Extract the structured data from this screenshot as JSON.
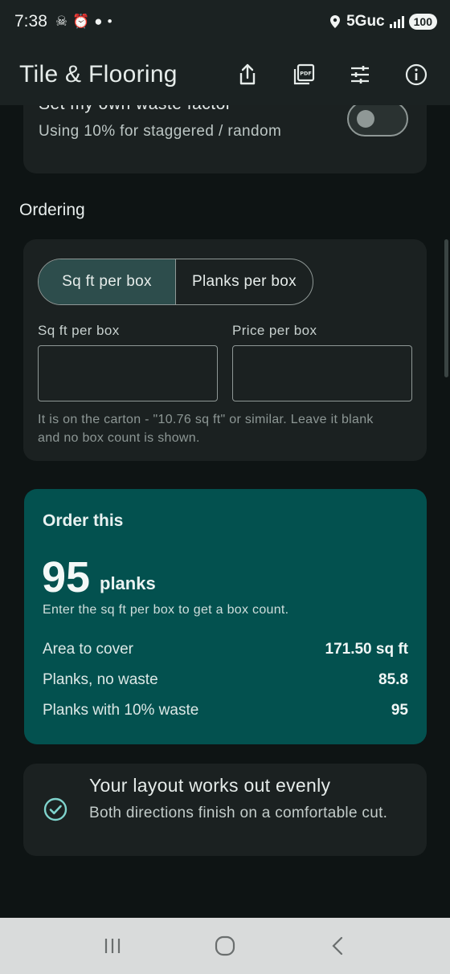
{
  "status_bar": {
    "time": "7:38",
    "network": "5Guc",
    "battery": "100"
  },
  "app_bar": {
    "title": "Tile & Flooring",
    "actions": [
      "share-icon",
      "pdf-icon",
      "tune-icon",
      "info-icon"
    ]
  },
  "waste_setting": {
    "title": "Set my own waste factor",
    "subtitle": "Using 10% for staggered / random",
    "toggle_on": false
  },
  "ordering": {
    "section_label": "Ordering",
    "segments": [
      "Sq ft per box",
      "Planks per box"
    ],
    "selected_segment": "Sq ft per box",
    "field_sqft_label": "Sq ft per box",
    "field_sqft_value": "",
    "field_price_label": "Price per box",
    "field_price_value": "",
    "helper": "It is on the carton - \"10.76 sq ft\" or similar. Leave it blank and no box count is shown."
  },
  "result": {
    "title": "Order this",
    "count": "95",
    "unit": "planks",
    "note": "Enter the sq ft per box to get a box count.",
    "rows": [
      {
        "label": "Area to cover",
        "value": "171.50 sq ft"
      },
      {
        "label": "Planks, no waste",
        "value": "85.8"
      },
      {
        "label": "Planks with 10% waste",
        "value": "95"
      }
    ]
  },
  "layout_status": {
    "title": "Your layout works out evenly",
    "subtitle": "Both directions finish on a comfortable cut."
  },
  "colors": {
    "background": "#0e1414",
    "card": "#1b2121",
    "result_card": "#03514f",
    "accent": "#7fd3cc"
  }
}
